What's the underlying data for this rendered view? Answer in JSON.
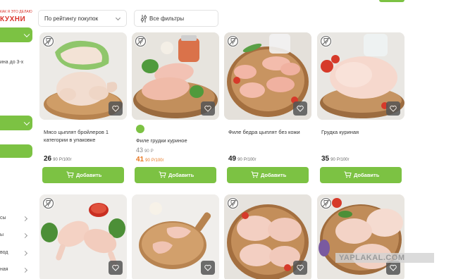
{
  "brand": {
    "small_text": "КАК Я ЭТО ДЕЛАЮ",
    "name": "КУХНИ"
  },
  "sidebar": {
    "text_delivery": "ина до 3-х",
    "items": [
      {
        "label": "сы"
      },
      {
        "label": "ы"
      },
      {
        "label": "вод"
      },
      {
        "label": "ная"
      }
    ]
  },
  "filters": {
    "sort_label": "По рейтингу покупок",
    "all_filters_label": "Все фильтры"
  },
  "products": [
    {
      "title": "Мясо цыплят бройлеров 1 категории в упаковке",
      "price_int": "26",
      "price_frac": "90",
      "unit": "Р/100г",
      "add_label": "Добавить"
    },
    {
      "title": "Филе грудки куриное",
      "old_int": "43",
      "old_frac": "90",
      "old_unit": "Р",
      "price_int": "41",
      "price_frac": "90",
      "unit": "Р/100г",
      "add_label": "Добавить"
    },
    {
      "title": "Филе бедра цыплят без кожи",
      "price_int": "49",
      "price_frac": "90",
      "unit": "Р/100г",
      "add_label": "Добавить"
    },
    {
      "title": "Грудка куриная",
      "price_int": "35",
      "price_frac": "90",
      "unit": "Р/100г",
      "add_label": "Добавить"
    }
  ],
  "watermark": "YAPLAKAL.COM",
  "colors": {
    "accent": "#7cc243",
    "promo_price": "#e87722",
    "brand_red": "#d9332b"
  },
  "icons": {
    "no_alcohol": "no-alcohol-icon",
    "favorite": "heart-icon",
    "cart": "cart-icon",
    "filter": "filter-sliders-icon"
  }
}
